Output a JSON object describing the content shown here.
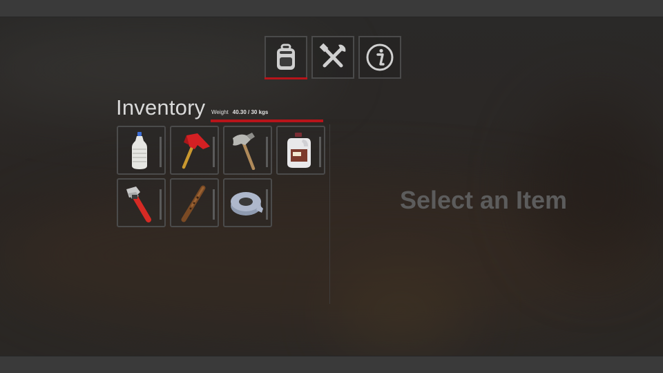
{
  "tabs": [
    {
      "icon": "backpack-icon",
      "active": true
    },
    {
      "icon": "crafting-tools-icon",
      "active": false
    },
    {
      "icon": "info-icon",
      "active": false
    }
  ],
  "inventory": {
    "title": "Inventory",
    "weight_label": "Weight",
    "weight_value": "40.30 / 30 kgs",
    "weight_fill_fraction": 1.0,
    "items": [
      {
        "icon": "water-bottle-icon"
      },
      {
        "icon": "fire-axe-icon"
      },
      {
        "icon": "hatchet-icon"
      },
      {
        "icon": "bleach-jug-icon"
      },
      {
        "icon": "pipe-wrench-icon"
      },
      {
        "icon": "baseball-bat-icon"
      },
      {
        "icon": "duct-tape-icon"
      }
    ]
  },
  "detail": {
    "placeholder": "Select an Item"
  },
  "colors": {
    "accent": "#b8141a",
    "panel_border": "#4b4b4b",
    "title_text": "#d9d9d9",
    "placeholder_text": "#5c5c5c"
  }
}
